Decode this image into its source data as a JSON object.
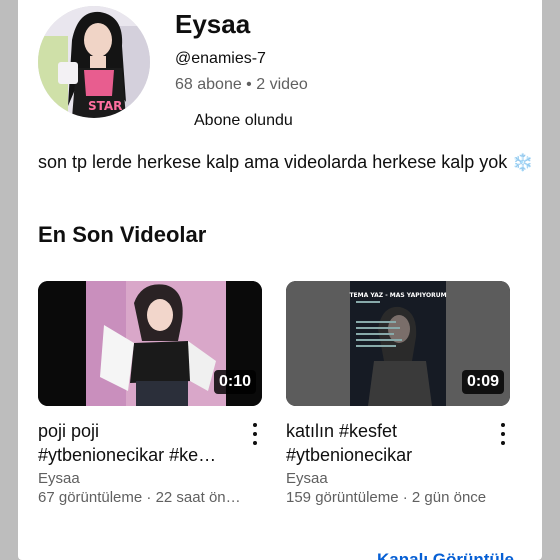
{
  "channel": {
    "name": "Eysaa",
    "handle": "@enamies-7",
    "stats": "68 abone • 2 video",
    "subscribe_label": "Abone olundu",
    "avatar_caption": "STAR"
  },
  "description": "son tp lerde herkese kalp ama videolarda herkese kalp yok",
  "description_emoji": "❄️",
  "section_title": "En Son Videolar",
  "videos": [
    {
      "title": "poji poji\n#ytbenionecikar #ke…",
      "duration": "0:10",
      "channel": "Eysaa",
      "meta": "67 görüntüleme · 22 saat ön…"
    },
    {
      "title": "katılın #kesfet\n#ytbenionecikar",
      "duration": "0:09",
      "channel": "Eysaa",
      "meta": "159 görüntüleme · 2 gün önce",
      "thumb_text": "TEMA YAZ - MAS YAPIYORUM"
    }
  ],
  "view_all_label": "Kanalı Görüntüle",
  "colors": {
    "link": "#065fd4",
    "secondary_text": "#606060",
    "backdrop": "#bdbdbd"
  }
}
